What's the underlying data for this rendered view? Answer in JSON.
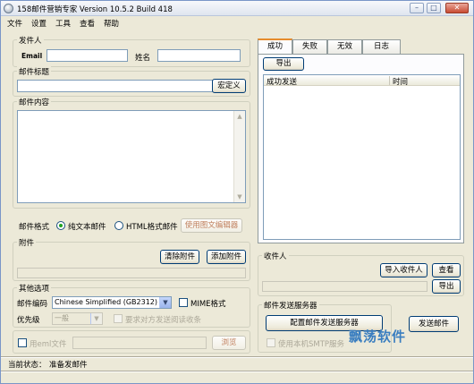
{
  "window": {
    "title": "158邮件营销专家 Version 10.5.2 Build 418",
    "minimize_glyph": "–",
    "maximize_glyph": "□",
    "close_glyph": "✕"
  },
  "menu": [
    "文件",
    "设置",
    "工具",
    "查看",
    "帮助"
  ],
  "sender": {
    "legend": "发件人",
    "email_label": "Email",
    "email_value": "",
    "name_label": "姓名",
    "name_value": ""
  },
  "subject": {
    "legend": "邮件标题",
    "value": "",
    "macro_button": "宏定义"
  },
  "content": {
    "legend": "邮件内容",
    "value": "",
    "scroll_up": "▲",
    "scroll_down": "▼"
  },
  "format": {
    "label": "邮件格式",
    "plain_label": "纯文本邮件",
    "html_label": "HTML格式邮件",
    "selected": "plain",
    "editor_button": "使用图文编辑器"
  },
  "attachment": {
    "legend": "附件",
    "clear_button": "清除附件",
    "add_button": "添加附件"
  },
  "other": {
    "legend": "其他选项",
    "encoding_label": "邮件编码",
    "encoding_value": "Chinese Simplified (GB2312)",
    "mime_label": "MIME格式",
    "mime_checked": false,
    "priority_label": "优先级",
    "priority_value": "一般",
    "receipt_label": "要求对方发送阅读收条",
    "receipt_checked": false,
    "dropdown_glyph": "▼"
  },
  "eml": {
    "label": "用eml文件",
    "checked": false,
    "path": "",
    "browse_button": "浏览"
  },
  "tabs": [
    "成功",
    "失败",
    "无效",
    "日志"
  ],
  "active_tab": "成功",
  "results": {
    "export_button": "导出",
    "columns": [
      "成功发送",
      "时间"
    ],
    "rows": []
  },
  "recipients": {
    "legend": "收件人",
    "import_button": "导入收件人",
    "view_button": "查看",
    "export_button": "导出",
    "value": ""
  },
  "smtp": {
    "legend": "邮件发送服务器",
    "configure_button": "配置邮件发送服务器",
    "local_smtp_label": "使用本机SMTP服务",
    "local_smtp_checked": false
  },
  "send_button": "发送邮件",
  "status": {
    "label": "当前状态：",
    "value": "准备发邮件"
  },
  "watermark": "飘荡软件"
}
